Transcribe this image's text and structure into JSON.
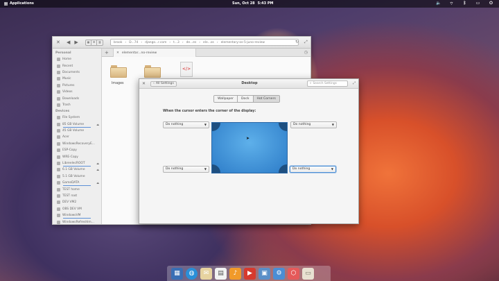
{
  "panel": {
    "applications_label": "Applications",
    "date": "Sun, Oct 28",
    "time": "5:43 PM",
    "tray": [
      "volume-icon",
      "wifi-icon",
      "bluetooth-icon",
      "notifications-icon",
      "power-icon"
    ]
  },
  "file_manager": {
    "path_segments": [
      "brook",
      "D...74",
      "django...r.com",
      "t...3",
      "de...es",
      "ele...os",
      "elementary-os-5-juno-review"
    ],
    "tab_label": "elementar...no-review",
    "sidebar": {
      "personal_header": "Personal",
      "personal": [
        "Home",
        "Recent",
        "Documents",
        "Music",
        "Pictures",
        "Videos",
        "Downloads",
        "Trash"
      ],
      "devices_header": "Devices",
      "devices": [
        "File System",
        "85 GB Volume",
        "45 GB Volume",
        "Acer",
        "WindowsRecoveryE...",
        "ESP-Copy",
        "WRE-Copy",
        "LibreelecROOT",
        "6.1 GB Volume",
        "5.1 GB Volume",
        "GameDATA",
        "TEST home",
        "TEST root",
        "DEV VM2",
        "OBS DEV VM",
        "WindowsVM",
        "WindowsRefreshlm..."
      ]
    },
    "files": [
      {
        "name": "Images",
        "type": "folder"
      },
      {
        "name": "",
        "type": "folder"
      },
      {
        "name": "",
        "type": "html"
      }
    ]
  },
  "settings": {
    "back_label": "All Settings",
    "title": "Desktop",
    "search_placeholder": "Search Settings",
    "tabs": [
      "Wallpaper",
      "Dock",
      "Hot Corners"
    ],
    "active_tab": "Hot Corners",
    "lead_text": "When the cursor enters the corner of the display:",
    "corners": {
      "top_left": "Do nothing",
      "top_right": "Do nothing",
      "bottom_left": "Do nothing",
      "bottom_right": "Do nothing"
    }
  },
  "dock_apps": [
    "multitasking-view",
    "web-browser",
    "mail",
    "calendar",
    "music",
    "videos",
    "photos",
    "system-settings",
    "app-center",
    "files"
  ]
}
